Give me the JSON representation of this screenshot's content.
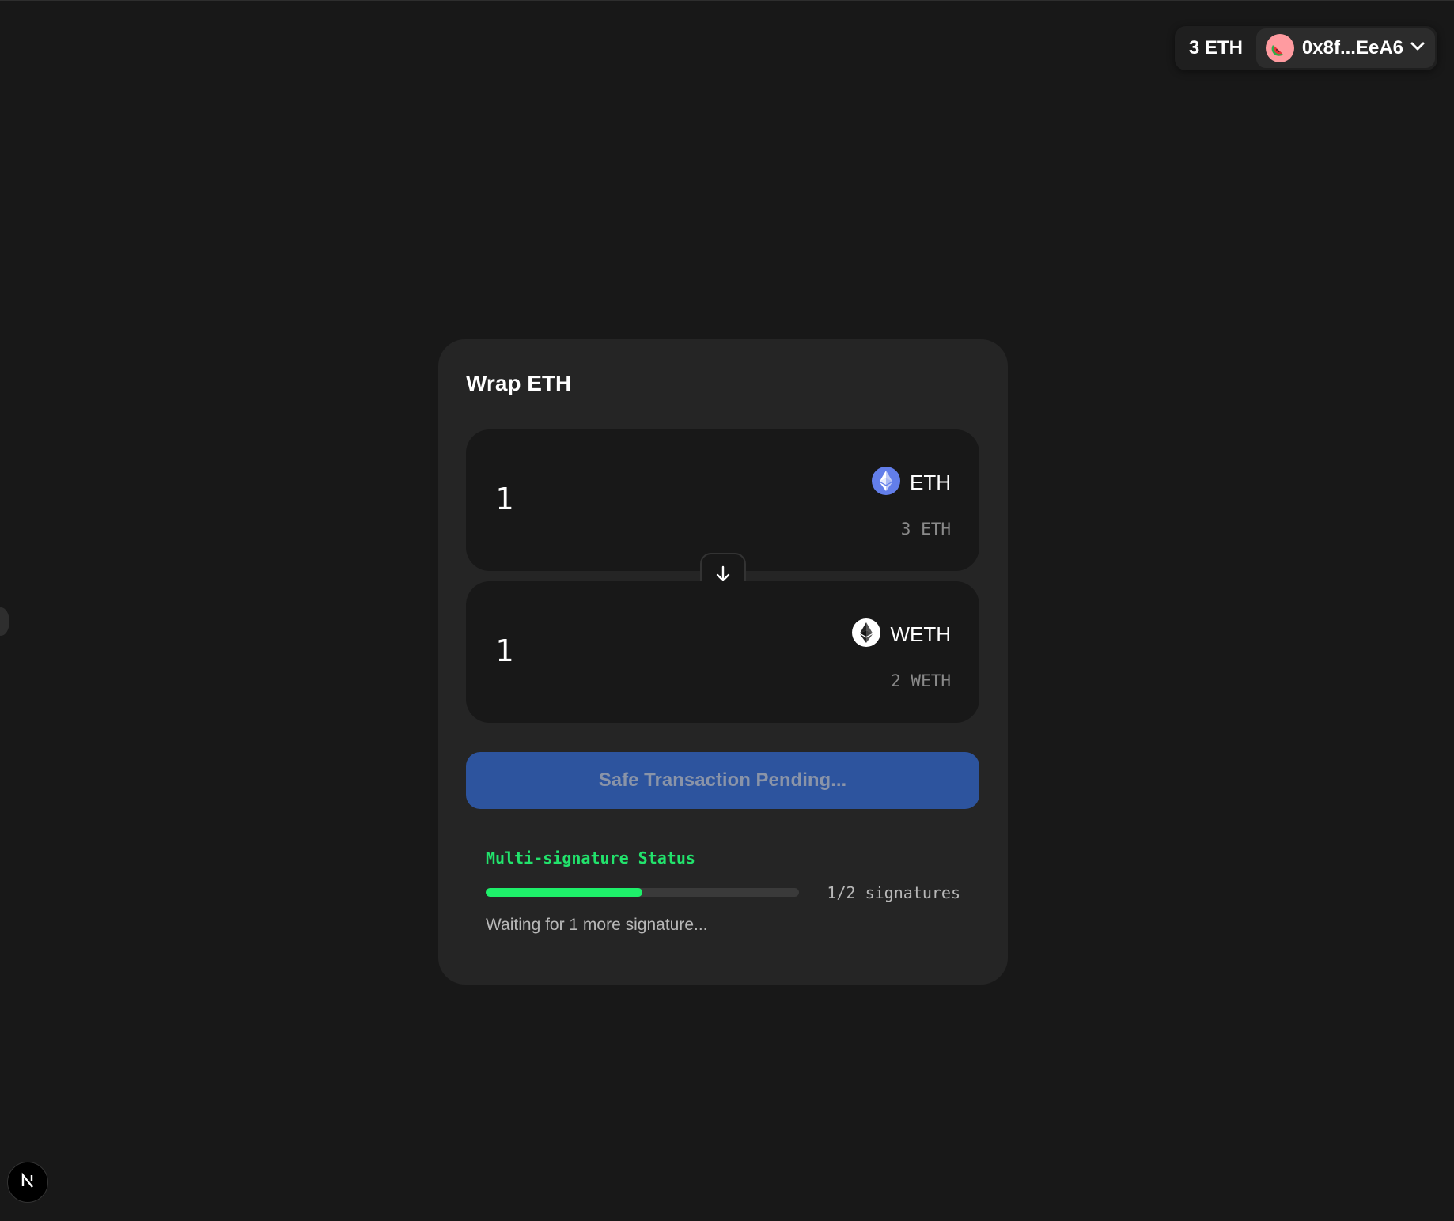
{
  "wallet": {
    "balance": "3 ETH",
    "address": "0x8f...EeA6",
    "avatar_icon": "watermelon-icon",
    "dropdown_icon": "chevron-down-icon"
  },
  "card": {
    "title": "Wrap ETH",
    "from": {
      "amount": "1",
      "token": "ETH",
      "token_icon": "ethereum-icon",
      "balance": "3 ETH"
    },
    "swap_icon": "arrow-down-icon",
    "to": {
      "amount": "1",
      "token": "WETH",
      "token_icon": "weth-icon",
      "balance": "2 WETH"
    },
    "action_button": "Safe Transaction Pending...",
    "multisig": {
      "label": "Multi-signature Status",
      "progress": 0.5,
      "count": "1/2 signatures",
      "waiting": "Waiting for 1 more signature..."
    }
  },
  "colors": {
    "background": "#181818",
    "card": "#252525",
    "button": "#2d549e",
    "progress": "#1ef06a",
    "status_label": "#22e36c",
    "eth_badge": "#627eea"
  },
  "nextjs_badge": "N"
}
